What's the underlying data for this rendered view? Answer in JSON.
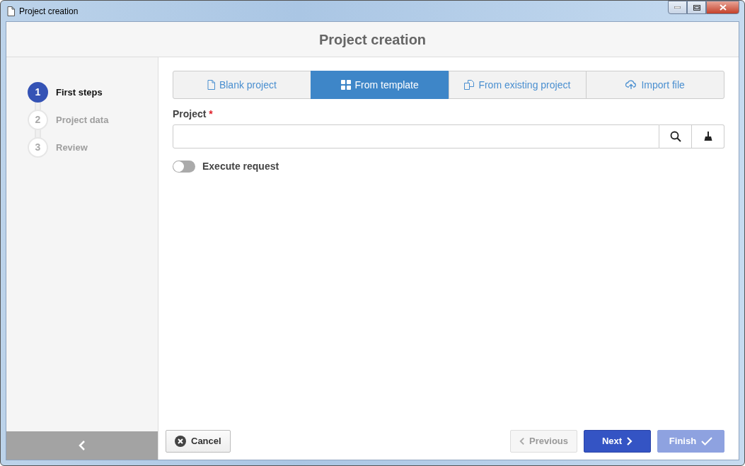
{
  "window": {
    "title": "Project creation"
  },
  "header": {
    "title": "Project creation"
  },
  "steps": [
    {
      "number": "1",
      "label": "First steps",
      "selected": true
    },
    {
      "number": "2",
      "label": "Project data",
      "selected": false
    },
    {
      "number": "3",
      "label": "Review",
      "selected": false
    }
  ],
  "tabs": [
    {
      "label": "Blank project",
      "selected": false
    },
    {
      "label": "From template",
      "selected": true
    },
    {
      "label": "From existing project",
      "selected": false
    },
    {
      "label": "Import file",
      "selected": false
    }
  ],
  "project_field": {
    "label": "Project",
    "required_mark": "*"
  },
  "toggle": {
    "label": "Execute request",
    "on": false
  },
  "buttons": [
    {
      "kind": "cancel",
      "label": "Cancel",
      "disabled": false
    },
    {
      "kind": "previous",
      "label": "Previous",
      "disabled": true
    },
    {
      "kind": "next",
      "label": "Next",
      "disabled": false
    },
    {
      "kind": "finish",
      "label": "Finish",
      "disabled": true
    }
  ]
}
